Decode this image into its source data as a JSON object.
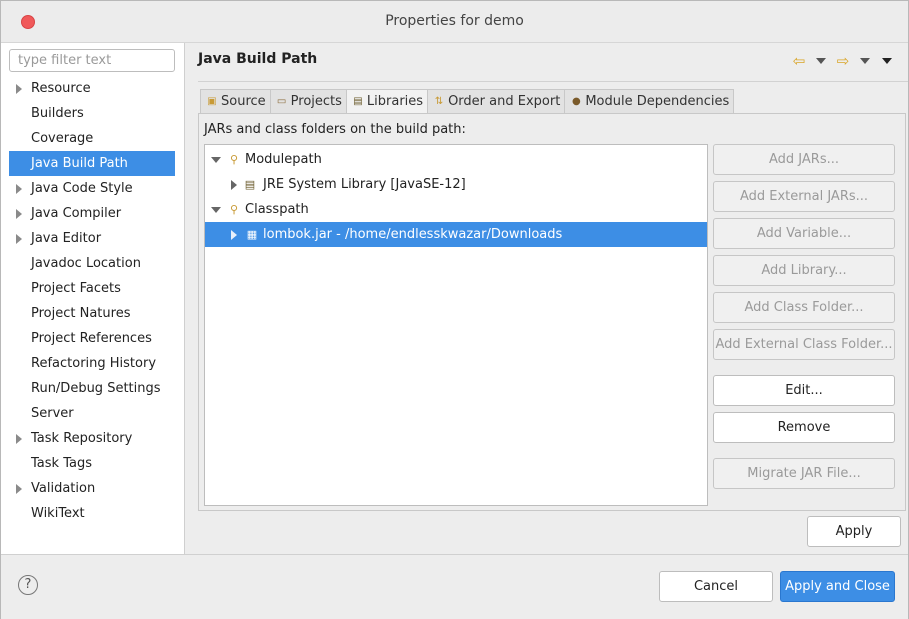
{
  "window": {
    "title": "Properties for demo"
  },
  "sidebar": {
    "filter_placeholder": "type filter text",
    "items": [
      {
        "label": "Resource",
        "expandable": true
      },
      {
        "label": "Builders",
        "expandable": false
      },
      {
        "label": "Coverage",
        "expandable": false
      },
      {
        "label": "Java Build Path",
        "expandable": false,
        "selected": true
      },
      {
        "label": "Java Code Style",
        "expandable": true
      },
      {
        "label": "Java Compiler",
        "expandable": true
      },
      {
        "label": "Java Editor",
        "expandable": true
      },
      {
        "label": "Javadoc Location",
        "expandable": false
      },
      {
        "label": "Project Facets",
        "expandable": false
      },
      {
        "label": "Project Natures",
        "expandable": false
      },
      {
        "label": "Project References",
        "expandable": false
      },
      {
        "label": "Refactoring History",
        "expandable": false
      },
      {
        "label": "Run/Debug Settings",
        "expandable": false
      },
      {
        "label": "Server",
        "expandable": false
      },
      {
        "label": "Task Repository",
        "expandable": true
      },
      {
        "label": "Task Tags",
        "expandable": false
      },
      {
        "label": "Validation",
        "expandable": true
      },
      {
        "label": "WikiText",
        "expandable": false
      }
    ]
  },
  "main": {
    "title": "Java Build Path",
    "tabs": [
      {
        "label": "Source",
        "icon": "source-folder-icon"
      },
      {
        "label": "Projects",
        "icon": "projects-folder-icon"
      },
      {
        "label": "Libraries",
        "icon": "libraries-icon",
        "active": true
      },
      {
        "label": "Order and Export",
        "icon": "order-export-icon"
      },
      {
        "label": "Module Dependencies",
        "icon": "module-icon"
      }
    ],
    "panel_label": "JARs and class folders on the build path:",
    "tree": [
      {
        "label": "Modulepath",
        "level": 0,
        "expanded": true
      },
      {
        "label": "JRE System Library [JavaSE-12]",
        "level": 1,
        "expanded": false
      },
      {
        "label": "Classpath",
        "level": 0,
        "expanded": true
      },
      {
        "label": "lombok.jar - /home/endlesskwazar/Downloads",
        "level": 1,
        "expanded": false,
        "selected": true
      }
    ],
    "buttons": {
      "add_jars": "Add JARs...",
      "add_external_jars": "Add External JARs...",
      "add_variable": "Add Variable...",
      "add_library": "Add Library...",
      "add_class_folder": "Add Class Folder...",
      "add_external_class_folder": "Add External Class Folder...",
      "edit": "Edit...",
      "remove": "Remove",
      "migrate_jar": "Migrate JAR File..."
    },
    "apply": "Apply"
  },
  "footer": {
    "help": "?",
    "cancel": "Cancel",
    "apply_close": "Apply and Close"
  },
  "colors": {
    "accent": "#3d8ee5",
    "close": "#f0595a"
  }
}
